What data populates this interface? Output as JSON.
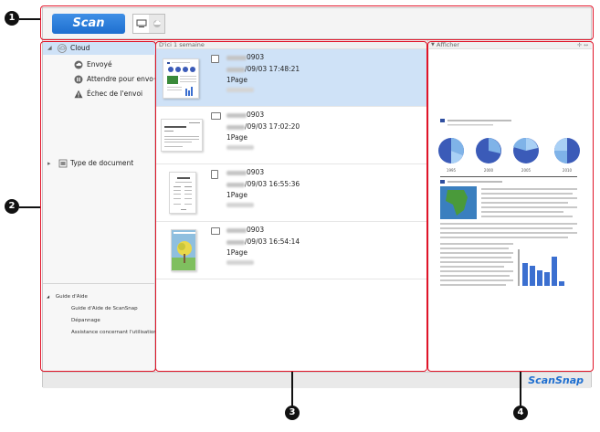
{
  "toolbar": {
    "scan_label": "Scan"
  },
  "sidebar": {
    "cloud": "Cloud",
    "sent": "Envoyé",
    "waiting": "Attendre pour envo···",
    "failed": "Échec de l'envoi",
    "doc_type": "Type de document"
  },
  "help": {
    "title": "Guide d'Aide",
    "items": [
      "Guide d'Aide de ScanSnap",
      "Dépannage",
      "Assistance concernant l'utilisation"
    ]
  },
  "list": {
    "group_header": "D'ici 1 semaine",
    "rows": [
      {
        "title_suffix": "0903",
        "date_suffix": "/09/03 17:48:21",
        "pages": "1Page"
      },
      {
        "title_suffix": "0903",
        "date_suffix": "/09/03 17:02:20",
        "pages": "1Page"
      },
      {
        "title_suffix": "0903",
        "date_suffix": "/09/03 16:55:36",
        "pages": "1Page"
      },
      {
        "title_suffix": "0903",
        "date_suffix": "/09/03 16:54:14",
        "pages": "1Page"
      }
    ]
  },
  "preview": {
    "header": "Afficher",
    "pie_labels": [
      "1995",
      "2000",
      "2005",
      "2010"
    ]
  },
  "status": {
    "logo": "ScanSnap"
  },
  "callouts": [
    "1",
    "2",
    "3",
    "4"
  ],
  "colors": {
    "accent": "#1e6fd0",
    "selection": "#cfe2f7",
    "callout": "#e01428"
  }
}
